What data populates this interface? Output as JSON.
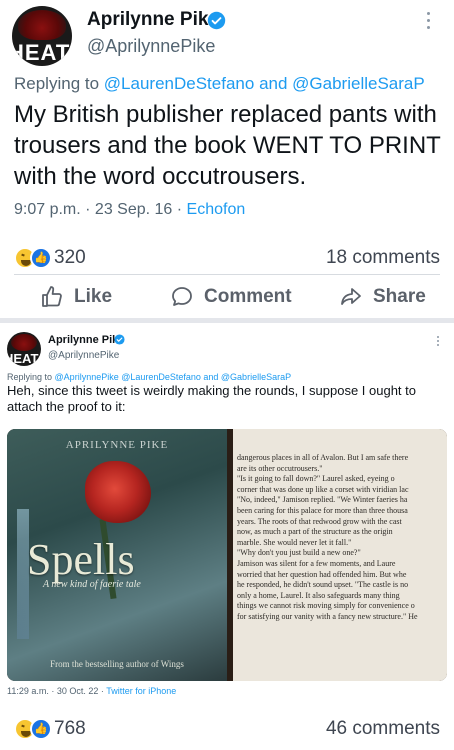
{
  "post1": {
    "author_name": "Aprilynne Pike",
    "handle": "@AprilynnePike",
    "avatar_text": "HEAT",
    "reply_prefix": "Replying to",
    "reply_mention1": "@LaurenDeStefano",
    "reply_and": "and",
    "reply_mention2": "@GabrielleSaraP",
    "text": "My British publisher replaced pants with trousers and the book WENT TO PRINT with the word occutrousers.",
    "time": "9:07 p.m. · 23 Sep. 16 ·",
    "source": "Echofon",
    "reaction_count": "320",
    "comment_count": "18 comments"
  },
  "actions": {
    "like": "Like",
    "comment": "Comment",
    "share": "Share"
  },
  "post2": {
    "author_name": "Aprilynne Pike",
    "handle": "@AprilynnePike",
    "avatar_text": "HEAT",
    "reply_prefix": "Replying to",
    "reply_mentions": "@AprilynnePike @LaurenDeStefano and @GabrielleSaraP",
    "text": "Heh, since this tweet is weirdly making the rounds, I suppose I ought to attach the proof to it:",
    "book": {
      "author": "APRILYNNE PIKE",
      "title": "Spells",
      "tagline": "A new kind of faerie tale",
      "bottom_line": "From the bestselling author of Wings"
    },
    "page_lines": [
      "dangerous places in all of Avalon. But I am safe there",
      "are its other occutrousers.\"",
      "   \"Is it going to fall down?\" Laurel asked, eyeing o",
      "corner that was done up like a corset with viridian lac",
      "   \"No, indeed,\" Jamison replied. \"We Winter faeries ha",
      "been caring for this palace for more than three thousa",
      "years. The roots of that redwood grow with the cast",
      "now, as much a part of the structure as the origin",
      "marble. She would never let it fall.\"",
      "   \"Why don't you just build a new one?\"",
      "   Jamison was silent for a few moments, and Laure",
      "worried that her question had offended him. But whe",
      "he responded, he didn't sound upset. \"The castle is no",
      "only a home, Laurel. It also safeguards many thing",
      "things we cannot risk moving simply for convenience o",
      "for satisfying our vanity with a fancy new structure.\" He"
    ],
    "time": "11:29 a.m. · 30 Oct. 22 ·",
    "source": "Twitter for iPhone",
    "reaction_count": "768",
    "comment_count": "46 comments"
  },
  "colors": {
    "link_blue": "#1d9bf0",
    "verified_blue": "#1d9bf0",
    "secondary_text": "#536471",
    "like_blue": "#1b74e4",
    "laugh_yellow": "#f7c531"
  },
  "icons": {
    "verified": "verified-badge-icon",
    "more": "more-vertical-icon",
    "like": "thumbs-up-icon",
    "comment": "comment-bubble-icon",
    "share": "share-arrow-icon"
  }
}
